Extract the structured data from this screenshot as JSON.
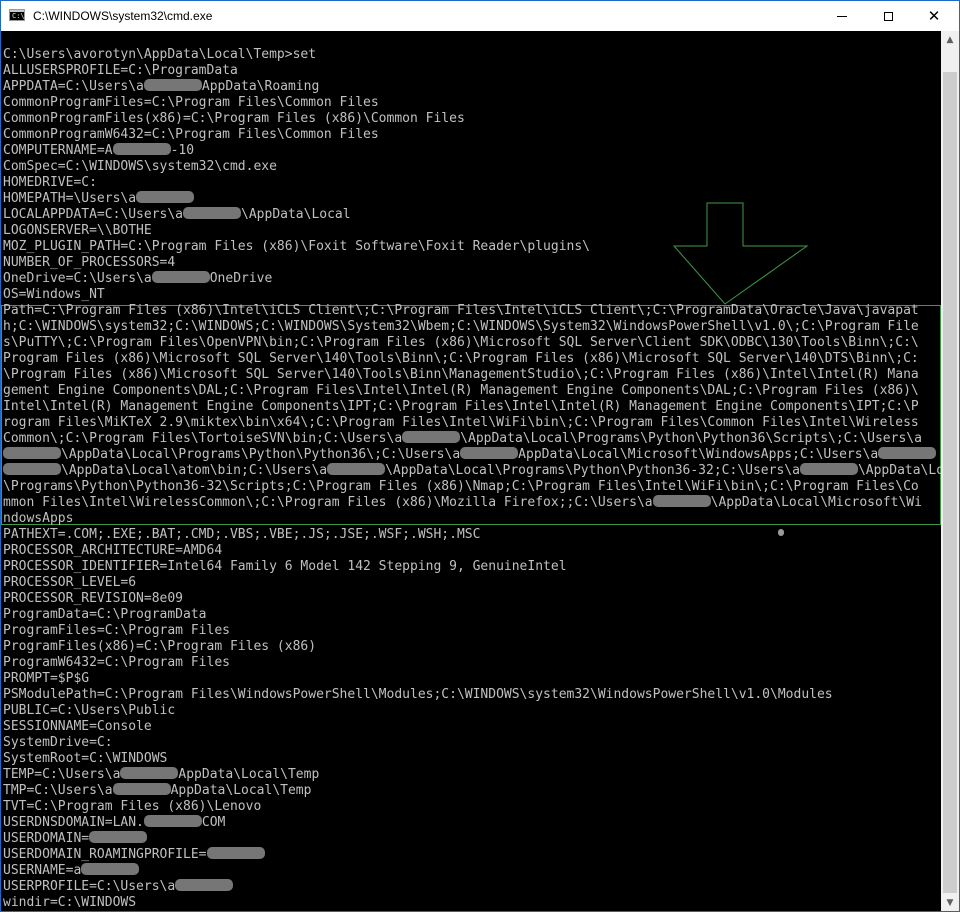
{
  "window": {
    "title": "C:\\WINDOWS\\system32\\cmd.exe",
    "icon": "console-icon",
    "icon_glyph": "C:\\",
    "controls": {
      "minimize": "minimize-icon",
      "maximize": "maximize-icon",
      "close": "close-icon",
      "close_glyph": "✕"
    }
  },
  "colors": {
    "background": "#000000",
    "text": "#c0c0c0",
    "highlight_box": "#3f9a46",
    "titlebar": "#ffffff",
    "border": "#1b6ac9"
  },
  "console": {
    "lines": [
      [
        "C:\\Users\\avorotyn\\AppData\\Local\\Temp>set"
      ],
      [
        "ALLUSERSPROFILE=C:\\ProgramData"
      ],
      [
        "APPDATA=C:\\Users\\a",
        "",
        "AppData\\Roaming"
      ],
      [
        "CommonProgramFiles=C:\\Program Files\\Common Files"
      ],
      [
        "CommonProgramFiles(x86)=C:\\Program Files (x86)\\Common Files"
      ],
      [
        "CommonProgramW6432=C:\\Program Files\\Common Files"
      ],
      [
        "COMPUTERNAME=A",
        "",
        "-10"
      ],
      [
        "ComSpec=C:\\WINDOWS\\system32\\cmd.exe"
      ],
      [
        "HOMEDRIVE=C:"
      ],
      [
        "HOMEPATH=\\Users\\a",
        ""
      ],
      [
        "LOCALAPPDATA=C:\\Users\\a",
        "",
        "\\AppData\\Local"
      ],
      [
        "LOGONSERVER=\\\\BOTHE"
      ],
      [
        "MOZ_PLUGIN_PATH=C:\\Program Files (x86)\\Foxit Software\\Foxit Reader\\plugins\\"
      ],
      [
        "NUMBER_OF_PROCESSORS=4"
      ],
      [
        "OneDrive=C:\\Users\\a",
        "",
        "OneDrive"
      ],
      [
        "OS=Windows_NT"
      ],
      [
        "Path=C:\\Program Files (x86)\\Intel\\iCLS Client\\;C:\\Program Files\\Intel\\iCLS Client\\;C:\\ProgramData\\Oracle\\Java\\javapat"
      ],
      [
        "h;C:\\WINDOWS\\system32;C:\\WINDOWS;C:\\WINDOWS\\System32\\Wbem;C:\\WINDOWS\\System32\\WindowsPowerShell\\v1.0\\;C:\\Program File"
      ],
      [
        "s\\PuTTY\\;C:\\Program Files\\OpenVPN\\bin;C:\\Program Files (x86)\\Microsoft SQL Server\\Client SDK\\ODBC\\130\\Tools\\Binn\\;C:\\"
      ],
      [
        "Program Files (x86)\\Microsoft SQL Server\\140\\Tools\\Binn\\;C:\\Program Files (x86)\\Microsoft SQL Server\\140\\DTS\\Binn\\;C:"
      ],
      [
        "\\Program Files (x86)\\Microsoft SQL Server\\140\\Tools\\Binn\\ManagementStudio\\;C:\\Program Files (x86)\\Intel\\Intel(R) Mana"
      ],
      [
        "gement Engine Components\\DAL;C:\\Program Files\\Intel\\Intel(R) Management Engine Components\\DAL;C:\\Program Files (x86)\\"
      ],
      [
        "Intel\\Intel(R) Management Engine Components\\IPT;C:\\Program Files\\Intel\\Intel(R) Management Engine Components\\IPT;C:\\P"
      ],
      [
        "rogram Files\\MiKTeX 2.9\\miktex\\bin\\x64\\;C:\\Program Files\\Intel\\WiFi\\bin\\;C:\\Program Files\\Common Files\\Intel\\Wireless"
      ],
      [
        "Common\\;C:\\Program Files\\TortoiseSVN\\bin;C:\\Users\\a",
        "",
        "\\AppData\\Local\\Programs\\Python\\Python36\\Scripts\\;C:\\Users\\a"
      ],
      [
        "",
        "\\AppData\\Local\\Programs\\Python\\Python36\\;C:\\Users\\a",
        "",
        "AppData\\Local\\Microsoft\\WindowsApps;C:\\Users\\a",
        ""
      ],
      [
        "",
        "\\AppData\\Local\\atom\\bin;C:\\Users\\a",
        "",
        "\\AppData\\Local\\Programs\\Python\\Python36-32;C:\\Users\\a",
        "",
        "\\AppData\\Local"
      ],
      [
        "\\Programs\\Python\\Python36-32\\Scripts;C:\\Program Files (x86)\\Nmap;C:\\Program Files\\Intel\\WiFi\\bin\\;C:\\Program Files\\Co"
      ],
      [
        "mmon Files\\Intel\\WirelessCommon\\;C:\\Program Files (x86)\\Mozilla Firefox;;C:\\Users\\a",
        "",
        "\\AppData\\Local\\Microsoft\\Wi"
      ],
      [
        "ndowsApps"
      ],
      [
        "PATHEXT=.COM;.EXE;.BAT;.CMD;.VBS;.VBE;.JS;.JSE;.WSF;.WSH;.MSC"
      ],
      [
        "PROCESSOR_ARCHITECTURE=AMD64"
      ],
      [
        "PROCESSOR_IDENTIFIER=Intel64 Family 6 Model 142 Stepping 9, GenuineIntel"
      ],
      [
        "PROCESSOR_LEVEL=6"
      ],
      [
        "PROCESSOR_REVISION=8e09"
      ],
      [
        "ProgramData=C:\\ProgramData"
      ],
      [
        "ProgramFiles=C:\\Program Files"
      ],
      [
        "ProgramFiles(x86)=C:\\Program Files (x86)"
      ],
      [
        "ProgramW6432=C:\\Program Files"
      ],
      [
        "PROMPT=$P$G"
      ],
      [
        "PSModulePath=C:\\Program Files\\WindowsPowerShell\\Modules;C:\\WINDOWS\\system32\\WindowsPowerShell\\v1.0\\Modules"
      ],
      [
        "PUBLIC=C:\\Users\\Public"
      ],
      [
        "SESSIONNAME=Console"
      ],
      [
        "SystemDrive=C:"
      ],
      [
        "SystemRoot=C:\\WINDOWS"
      ],
      [
        "TEMP=C:\\Users\\a",
        "",
        "AppData\\Local\\Temp"
      ],
      [
        "TMP=C:\\Users\\a",
        "",
        "AppData\\Local\\Temp"
      ],
      [
        "TVT=C:\\Program Files (x86)\\Lenovo"
      ],
      [
        "USERDNSDOMAIN=LAN.",
        "",
        "COM"
      ],
      [
        "USERDOMAIN=",
        ""
      ],
      [
        "USERDOMAIN_ROAMINGPROFILE=",
        ""
      ],
      [
        "USERNAME=a",
        ""
      ],
      [
        "USERPROFILE=C:\\Users\\a",
        ""
      ],
      [
        "windir=C:\\WINDOWS"
      ]
    ]
  },
  "annotation": {
    "arrow": "down-arrow-icon",
    "highlight": "Path"
  },
  "scrollbar": {
    "up": "scroll-up-icon",
    "down": "scroll-down-icon",
    "up_glyph": "▲",
    "down_glyph": "▼"
  }
}
